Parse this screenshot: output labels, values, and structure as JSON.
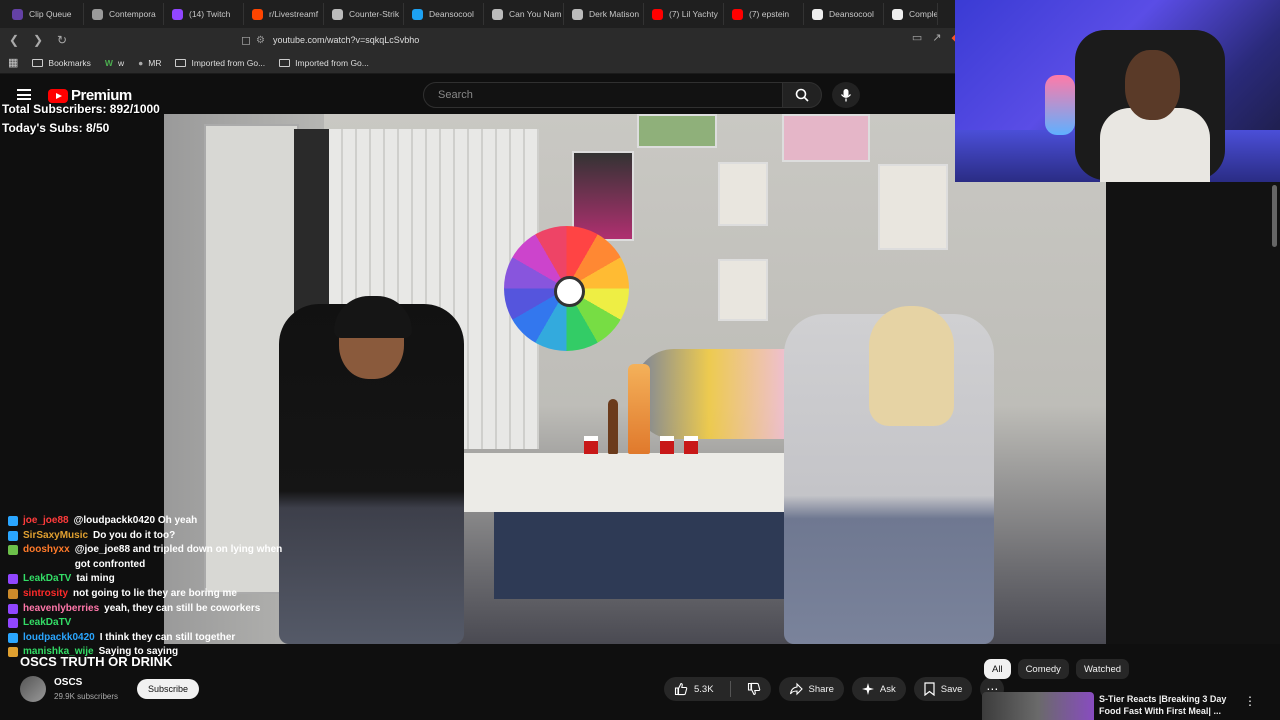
{
  "browser": {
    "tabs": [
      {
        "title": "Clip Queue",
        "color": "#6441a5"
      },
      {
        "title": "Contempora",
        "color": "#9a9a9a"
      },
      {
        "title": "(14) Twitch",
        "color": "#9146ff"
      },
      {
        "title": "r/Livestreamf",
        "color": "#ff4500"
      },
      {
        "title": "Counter-Strik",
        "color": "#bbbbbb"
      },
      {
        "title": "Deansocool",
        "color": "#1da1f2"
      },
      {
        "title": "Can You Nam",
        "color": "#bbbbbb"
      },
      {
        "title": "Derk Matison",
        "color": "#bbbbbb"
      },
      {
        "title": "(7) Lil Yachty",
        "color": "#ff0000"
      },
      {
        "title": "(7) epstein",
        "color": "#ff0000"
      },
      {
        "title": "Deansocool",
        "color": "#eeeeee"
      },
      {
        "title": "Complex",
        "color": "#eeeeee"
      }
    ],
    "url": "youtube.com/watch?v=sqkqLcSvbho",
    "bookmarks": [
      {
        "label": "Bookmarks"
      },
      {
        "label": "w"
      },
      {
        "label": "MR"
      },
      {
        "label": "Imported from Go..."
      },
      {
        "label": "Imported from Go..."
      }
    ]
  },
  "youtube": {
    "logo_text": "Premium",
    "search_placeholder": "Search",
    "accent": "#ff0000"
  },
  "overlay": {
    "total_subs": "Total Subscribers: 892/1000",
    "todays_subs": "Today's Subs: 8/50"
  },
  "chat": [
    {
      "user": "joe_joe88",
      "color": "#ff3b3b",
      "badge": "#2aa6ff",
      "msg": "@loudpackk0420 Oh yeah"
    },
    {
      "user": "SirSaxyMusic",
      "color": "#e0a030",
      "badge": "#2aa6ff",
      "msg": "Do you do it too?"
    },
    {
      "user": "dooshyxx",
      "color": "#ff7a2a",
      "badge": "#6cc04a",
      "msg": "@joe_joe88 and tripled down on lying when got confronted"
    },
    {
      "user": "LeakDaTV",
      "color": "#33dd66",
      "badge": "#9146ff",
      "msg": "tai ming"
    },
    {
      "user": "sintrosity",
      "color": "#ff2a2a",
      "badge": "#cc8a2a",
      "msg": "not going to lie they are boring me"
    },
    {
      "user": "heavenlyberries",
      "color": "#ff77aa",
      "badge": "#9146ff",
      "msg": "yeah, they can still be coworkers"
    },
    {
      "user": "LeakDaTV",
      "color": "#33dd66",
      "badge": "#9146ff",
      "msg": ""
    },
    {
      "user": "loudpackk0420",
      "color": "#2aa6ff",
      "badge": "#2aa6ff",
      "msg": "I think they can still together"
    },
    {
      "user": "manishka_wije",
      "color": "#33dd66",
      "badge": "#e0a030",
      "msg": "Saying to saying"
    }
  ],
  "video": {
    "title": "OSCS TRUTH OR DRINK",
    "channel": "OSCS",
    "subs": "29.9K subscribers",
    "subscribe": "Subscribe",
    "likes": "5.3K",
    "share": "Share",
    "ask": "Ask",
    "save": "Save"
  },
  "chips": [
    {
      "label": "All",
      "selected": true
    },
    {
      "label": "Comedy",
      "selected": false
    },
    {
      "label": "Watched",
      "selected": false
    }
  ],
  "recommendation": {
    "title": "S-Tier Reacts |Breaking 3 Day Food Fast With First Meal| ..."
  },
  "icons": {
    "back": "back-arrow-icon",
    "forward": "forward-arrow-icon",
    "reload": "reload-icon",
    "search": "search-icon",
    "mic": "mic-icon",
    "like": "thumbs-up-icon",
    "dislike": "thumbs-down-icon",
    "share": "share-icon",
    "ask": "sparkle-icon",
    "save": "bookmark-icon"
  }
}
